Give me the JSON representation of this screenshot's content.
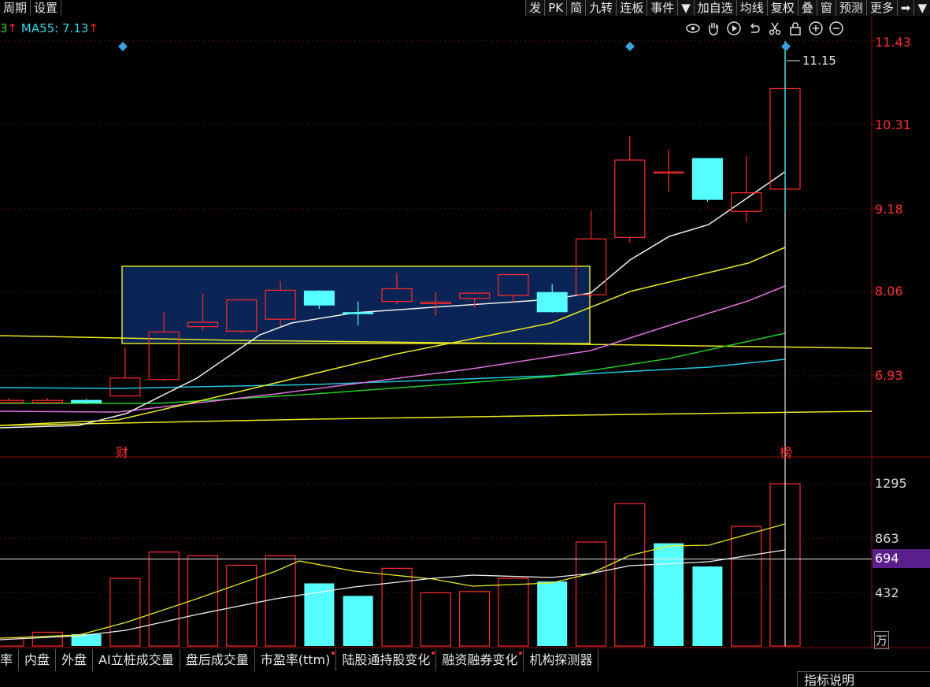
{
  "toolbar": {
    "left": [
      "周期",
      "设置"
    ],
    "right": [
      "发",
      "PK",
      "简",
      "九转",
      "连板",
      "事件",
      "▼",
      "加自选",
      "均线",
      "复权",
      "叠",
      "窗",
      "预测",
      "更多",
      "➡",
      "▼"
    ]
  },
  "ma_legend": {
    "fragment": "3",
    "fragment_arrow": "↑",
    "ma55": "MA55: 7.13",
    "ma55_arrow": "↑"
  },
  "tools": [
    "eye-icon",
    "hand-icon",
    "play-icon",
    "undo-icon",
    "scissors-icon",
    "lock-icon",
    "zoom-in-icon",
    "zoom-out-icon"
  ],
  "price_axis": {
    "labels": [
      "11.43",
      "10.31",
      "9.18",
      "8.06",
      "6.93"
    ],
    "max_marker": "11.15"
  },
  "volume_axis": {
    "labels": [
      "1295",
      "863",
      "432"
    ],
    "highlight": "694",
    "unit": "万"
  },
  "events": {
    "left_mark": "财",
    "right_mark": "榜"
  },
  "tabs": [
    {
      "label": "率",
      "dot": false
    },
    {
      "label": "内盘",
      "dot": false
    },
    {
      "label": "外盘",
      "dot": false
    },
    {
      "label": "AI立桩成交量",
      "dot": false
    },
    {
      "label": "盘后成交量",
      "dot": false
    },
    {
      "label": "市盈率(ttm)",
      "dot": true
    },
    {
      "label": "陆股通持股变化",
      "dot": true
    },
    {
      "label": "融资融券变化",
      "dot": true
    },
    {
      "label": "机构探测器",
      "dot": false
    }
  ],
  "help_button": "指标说明",
  "colors": {
    "up": "#ff2a2a",
    "down": "#55ffff",
    "box_fill": "#0a2456",
    "box_border": "#e0e020",
    "ma_white": "#f0f0f0",
    "ma_yellow": "#e8e820",
    "ma_pink": "#e070e0",
    "ma_green": "#22cc22",
    "ma_cyan": "#22c8e0"
  },
  "chart_data": {
    "type": "candlestick",
    "y_axis_ticks": [
      11.43,
      10.31,
      9.18,
      8.06,
      6.93
    ],
    "candles": [
      {
        "open": 6.57,
        "close": 6.6,
        "high": 6.63,
        "low": 6.55
      },
      {
        "open": 6.57,
        "close": 6.6,
        "high": 6.63,
        "low": 6.55
      },
      {
        "open": 6.6,
        "close": 6.57,
        "high": 6.62,
        "low": 6.55
      },
      {
        "open": 6.66,
        "close": 6.9,
        "high": 7.31,
        "low": 6.65
      },
      {
        "open": 6.88,
        "close": 7.52,
        "high": 7.79,
        "low": 6.86
      },
      {
        "open": 7.59,
        "close": 7.65,
        "high": 8.04,
        "low": 7.54
      },
      {
        "open": 7.53,
        "close": 7.95,
        "high": 7.96,
        "low": 7.5
      },
      {
        "open": 7.69,
        "close": 8.08,
        "high": 8.2,
        "low": 7.6
      },
      {
        "open": 8.07,
        "close": 7.88,
        "high": 8.08,
        "low": 7.83
      },
      {
        "open": 7.78,
        "close": 7.77,
        "high": 7.93,
        "low": 7.61
      },
      {
        "open": 7.93,
        "close": 8.1,
        "high": 8.31,
        "low": 7.89
      },
      {
        "open": 7.9,
        "close": 7.92,
        "high": 8.06,
        "low": 7.74
      },
      {
        "open": 7.97,
        "close": 8.04,
        "high": 8.06,
        "low": 7.85
      },
      {
        "open": 8.01,
        "close": 8.29,
        "high": 8.3,
        "low": 7.92
      },
      {
        "open": 8.05,
        "close": 7.79,
        "high": 8.16,
        "low": 7.78
      },
      {
        "open": 8.02,
        "close": 8.77,
        "high": 9.15,
        "low": 7.99
      },
      {
        "open": 8.79,
        "close": 9.83,
        "high": 10.15,
        "low": 8.72
      },
      {
        "open": 9.67,
        "close": 9.67,
        "high": 9.97,
        "low": 9.4
      },
      {
        "open": 9.85,
        "close": 9.3,
        "high": 9.85,
        "low": 9.27
      },
      {
        "open": 9.14,
        "close": 9.39,
        "high": 9.88,
        "low": 8.99
      },
      {
        "open": 9.44,
        "close": 10.79,
        "high": 11.15,
        "low": 9.27
      }
    ],
    "volumes": [
      {
        "value": 65,
        "up": true
      },
      {
        "value": 110,
        "up": true
      },
      {
        "value": 95,
        "up": false
      },
      {
        "value": 540,
        "up": true
      },
      {
        "value": 750,
        "up": true
      },
      {
        "value": 720,
        "up": true
      },
      {
        "value": 645,
        "up": true
      },
      {
        "value": 720,
        "up": true
      },
      {
        "value": 500,
        "up": false
      },
      {
        "value": 400,
        "up": false
      },
      {
        "value": 620,
        "up": true
      },
      {
        "value": 425,
        "up": true
      },
      {
        "value": 435,
        "up": true
      },
      {
        "value": 540,
        "up": true
      },
      {
        "value": 515,
        "up": false
      },
      {
        "value": 830,
        "up": true
      },
      {
        "value": 1135,
        "up": true
      },
      {
        "value": 820,
        "up": false
      },
      {
        "value": 635,
        "up": false
      },
      {
        "value": 955,
        "up": true
      },
      {
        "value": 1295,
        "up": true
      }
    ],
    "volume_axis_ticks": [
      1295,
      863,
      432
    ],
    "volume_ref_line": 694
  }
}
